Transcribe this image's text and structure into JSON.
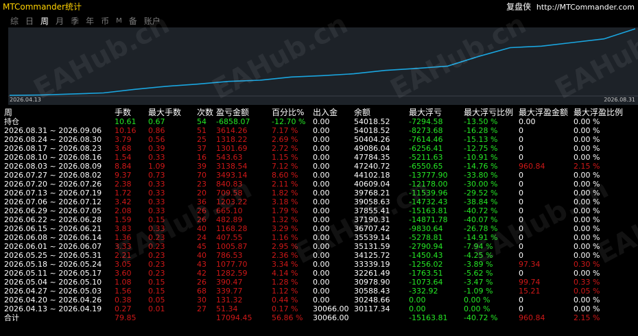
{
  "header": {
    "title": "MTCommander统计",
    "right_label": "复盘侠",
    "right_link": "http://MTCommander.com"
  },
  "period_tabs": [
    {
      "label": "综",
      "active": false
    },
    {
      "label": "日",
      "active": false
    },
    {
      "label": "周",
      "active": true
    },
    {
      "label": "月",
      "active": false
    },
    {
      "label": "季",
      "active": false
    },
    {
      "label": "年",
      "active": false
    },
    {
      "label": "币",
      "active": false
    },
    {
      "label": "M",
      "active": false
    },
    {
      "label": "备",
      "active": false
    },
    {
      "label": "账户",
      "active": false
    }
  ],
  "chart": {
    "start_label": "2026.04.13",
    "end_label": "2026.08.31",
    "line_color": "#1aa6e0",
    "background": "#1d2228"
  },
  "chart_data": {
    "type": "line",
    "x": [
      "2026.04.13",
      "2026.04.20",
      "2026.04.27",
      "2026.05.04",
      "2026.05.11",
      "2026.05.18",
      "2026.05.25",
      "2026.06.01",
      "2026.06.08",
      "2026.06.15",
      "2026.06.22",
      "2026.06.29",
      "2026.07.06",
      "2026.07.13",
      "2026.07.20",
      "2026.07.27",
      "2026.08.03",
      "2026.08.10",
      "2026.08.17",
      "2026.08.24",
      "2026.08.31"
    ],
    "values": [
      30117.34,
      30248.66,
      30588.43,
      30978.9,
      32261.49,
      33339.19,
      34125.72,
      35131.59,
      35539.14,
      36707.42,
      37190.31,
      37855.41,
      39058.63,
      39768.21,
      40609.04,
      44102.18,
      47240.72,
      47784.35,
      49086.04,
      50404.26,
      54018.52
    ],
    "grid": false
  },
  "table": {
    "headers": [
      "周",
      "手数",
      "最大手数",
      "次数",
      "盈亏金额",
      "百分比%",
      "出入金",
      "余额",
      "最大浮亏",
      "最大浮亏比例",
      "最大浮盈金额",
      "最大浮盈比例"
    ],
    "hold": [
      "持仓",
      "10.61",
      "0.67",
      "54",
      "-6858.07",
      "-12.70 %",
      "0.00",
      "54018.52",
      "-7294.58",
      "-13.50 %",
      "0.00",
      "0.00 %"
    ],
    "rows": [
      [
        "2026.08.31 ~ 2026.09.06",
        "10.16",
        "0.86",
        "51",
        "3614.26",
        "7.17 %",
        "0.00",
        "54018.52",
        "-8273.68",
        "-16.28 %",
        "0",
        "0.00 %"
      ],
      [
        "2026.08.24 ~ 2026.08.30",
        "3.79",
        "0.56",
        "25",
        "1318.22",
        "2.69 %",
        "0.00",
        "50404.26",
        "-7614.46",
        "-15.13 %",
        "0",
        "0.00 %"
      ],
      [
        "2026.08.17 ~ 2026.08.23",
        "3.68",
        "0.39",
        "37",
        "1301.69",
        "2.72 %",
        "0.00",
        "49086.04",
        "-6256.41",
        "-12.75 %",
        "0",
        "0.00 %"
      ],
      [
        "2026.08.10 ~ 2026.08.16",
        "1.54",
        "0.33",
        "16",
        "543.63",
        "1.15 %",
        "0.00",
        "47784.35",
        "-5211.63",
        "-10.91 %",
        "0",
        "0.00 %"
      ],
      [
        "2026.08.03 ~ 2026.08.09",
        "8.84",
        "1.09",
        "39",
        "3138.54",
        "7.12 %",
        "0.00",
        "47240.72",
        "-6550.65",
        "-14.76 %",
        "960.84",
        "2.15 %"
      ],
      [
        "2026.07.27 ~ 2026.08.02",
        "9.37",
        "0.73",
        "70",
        "3493.14",
        "8.60 %",
        "0.00",
        "44102.18",
        "-13777.90",
        "-33.80 %",
        "0",
        "0.00 %"
      ],
      [
        "2026.07.20 ~ 2026.07.26",
        "2.38",
        "0.33",
        "23",
        "840.83",
        "2.11 %",
        "0.00",
        "40609.04",
        "-12178.00",
        "-30.00 %",
        "0",
        "0.00 %"
      ],
      [
        "2026.07.13 ~ 2026.07.19",
        "1.72",
        "0.33",
        "20",
        "709.58",
        "1.82 %",
        "0.00",
        "39768.21",
        "-11539.96",
        "-29.52 %",
        "0",
        "0.00 %"
      ],
      [
        "2026.07.06 ~ 2026.07.12",
        "3.42",
        "0.33",
        "36",
        "1203.22",
        "3.18 %",
        "0.00",
        "39058.63",
        "-14732.43",
        "-38.84 %",
        "0",
        "0.00 %"
      ],
      [
        "2026.06.29 ~ 2026.07.05",
        "2.08",
        "0.33",
        "26",
        "665.10",
        "1.79 %",
        "0.00",
        "37855.41",
        "-15163.81",
        "-40.72 %",
        "0",
        "0.00 %"
      ],
      [
        "2026.06.22 ~ 2026.06.28",
        "1.59",
        "0.15",
        "26",
        "482.89",
        "1.32 %",
        "0.00",
        "37190.31",
        "-14871.78",
        "-40.07 %",
        "0",
        "0.00 %"
      ],
      [
        "2026.06.15 ~ 2026.06.21",
        "3.83",
        "0.33",
        "40",
        "1168.28",
        "3.29 %",
        "0.00",
        "36707.42",
        "-9830.64",
        "-26.78 %",
        "0",
        "0.00 %"
      ],
      [
        "2026.06.08 ~ 2026.06.14",
        "1.36",
        "0.23",
        "24",
        "407.55",
        "1.16 %",
        "0.00",
        "35539.14",
        "-5278.81",
        "-14.91 %",
        "0",
        "0.00 %"
      ],
      [
        "2026.06.01 ~ 2026.06.07",
        "3.33",
        "0.23",
        "45",
        "1005.87",
        "2.95 %",
        "0.00",
        "35131.59",
        "-2790.94",
        "-7.94 %",
        "0",
        "0.00 %"
      ],
      [
        "2026.05.25 ~ 2026.05.31",
        "2.21",
        "0.23",
        "40",
        "786.53",
        "2.36 %",
        "0.00",
        "34125.72",
        "-1450.43",
        "-4.25 %",
        "0",
        "0.00 %"
      ],
      [
        "2026.05.18 ~ 2026.05.24",
        "3.05",
        "0.23",
        "43",
        "1077.70",
        "3.34 %",
        "0.00",
        "33339.19",
        "-1256.02",
        "-3.89 %",
        "97.34",
        "0.30 %"
      ],
      [
        "2026.05.11 ~ 2026.05.17",
        "3.60",
        "0.23",
        "42",
        "1282.59",
        "4.14 %",
        "0.00",
        "32261.49",
        "-1763.51",
        "-5.62 %",
        "0",
        "0.00 %"
      ],
      [
        "2026.05.04 ~ 2026.05.10",
        "1.08",
        "0.15",
        "26",
        "390.47",
        "1.28 %",
        "0.00",
        "30978.90",
        "-1073.64",
        "-3.47 %",
        "99.74",
        "0.33 %"
      ],
      [
        "2026.04.27 ~ 2026.05.03",
        "1.56",
        "0.15",
        "68",
        "339.77",
        "1.12 %",
        "0.00",
        "30588.43",
        "-332.92",
        "-1.09 %",
        "15.21",
        "0.05 %"
      ],
      [
        "2026.04.20 ~ 2026.04.26",
        "0.38",
        "0.05",
        "30",
        "131.32",
        "0.44 %",
        "0.00",
        "30248.66",
        "0.00",
        "0.00 %",
        "0",
        "0.00 %"
      ],
      [
        "2026.04.13 ~ 2026.04.19",
        "0.27",
        "0.01",
        "27",
        "51.34",
        "0.17 %",
        "30066.00",
        "30117.34",
        "0.00",
        "0.00 %",
        "0",
        "0.00 %"
      ]
    ],
    "total": [
      "合计",
      "79.85",
      "",
      "",
      "17094.45",
      "56.86 %",
      "30066.00",
      "",
      "-15163.81",
      "-40.72 %",
      "960.84",
      "2.15 %"
    ]
  },
  "watermark": "EAHub.cn"
}
